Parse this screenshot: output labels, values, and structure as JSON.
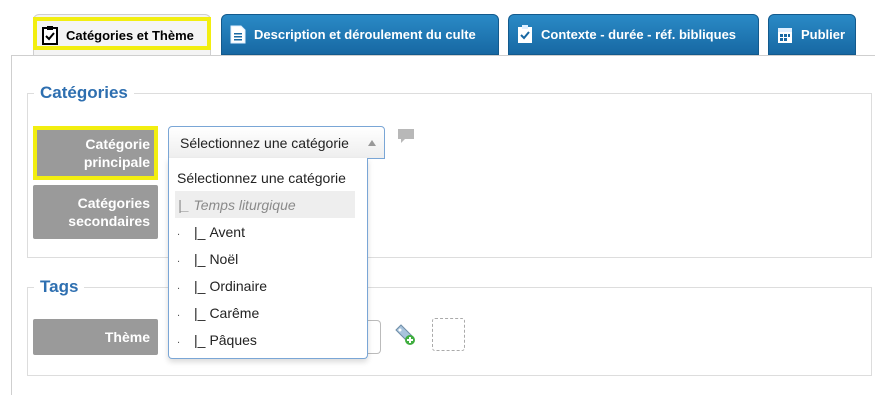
{
  "tabs": [
    {
      "label": "Catégories et Thème",
      "icon": "checklist-icon",
      "active": true
    },
    {
      "label": "Description et déroulement du culte",
      "icon": "document-icon",
      "active": false
    },
    {
      "label": "Contexte - durée - réf. bibliques",
      "icon": "checklist-icon",
      "active": false
    },
    {
      "label": "Publier",
      "icon": "calendar-icon",
      "active": false
    }
  ],
  "categories": {
    "legend": "Catégories",
    "main_label": "Catégorie principale",
    "secondary_label": "Catégories secondaires",
    "select_value": "Sélectionnez une catégorie",
    "options": [
      {
        "label": "Sélectionnez une catégorie",
        "prefix": ""
      },
      {
        "label": "Temps liturgique",
        "prefix": "|_"
      },
      {
        "label": "Avent",
        "prefix": "|_"
      },
      {
        "label": "Noël",
        "prefix": "|_"
      },
      {
        "label": "Ordinaire",
        "prefix": "|_"
      },
      {
        "label": "Carême",
        "prefix": "|_"
      },
      {
        "label": "Pâques",
        "prefix": "|_"
      }
    ]
  },
  "tags": {
    "legend": "Tags",
    "theme_label": "Thème"
  },
  "colors": {
    "tab_blue": "#1c73b0",
    "legend_blue": "#2e6fb0",
    "label_gray": "#9a9a9a",
    "highlight_yellow": "#f2ee10"
  }
}
